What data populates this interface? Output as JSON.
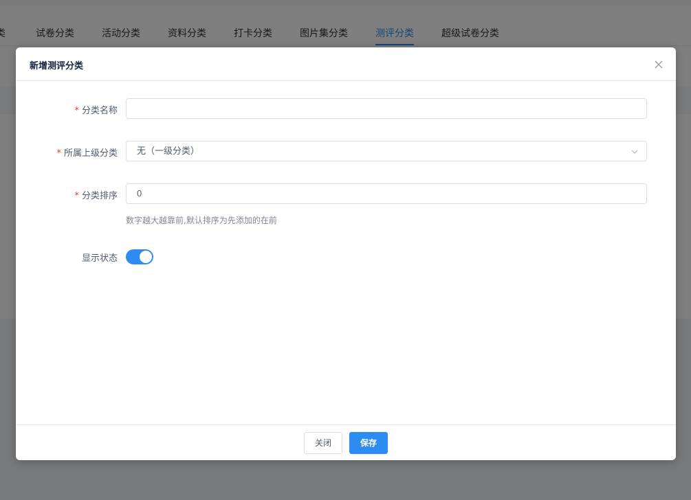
{
  "tabs": [
    {
      "label": "类"
    },
    {
      "label": "试卷分类"
    },
    {
      "label": "活动分类"
    },
    {
      "label": "资料分类"
    },
    {
      "label": "打卡分类"
    },
    {
      "label": "图片集分类"
    },
    {
      "label": "测评分类",
      "active": true
    },
    {
      "label": "超级试卷分类"
    }
  ],
  "dialog": {
    "title": "新增测评分类",
    "fields": {
      "name": {
        "required_mark": "*",
        "label": "分类名称",
        "value": "",
        "placeholder": ""
      },
      "parent": {
        "required_mark": "*",
        "label": "所属上级分类",
        "value": "无（一级分类）"
      },
      "sort": {
        "required_mark": "*",
        "label": "分类排序",
        "value": "0",
        "hint": "数字越大越靠前,默认排序为先添加的在前"
      },
      "status": {
        "label": "显示状态",
        "enabled": true
      }
    },
    "buttons": {
      "close": "关闭",
      "save": "保存"
    }
  },
  "colors": {
    "accent": "#2d8cf0",
    "required": "#ed4014"
  }
}
